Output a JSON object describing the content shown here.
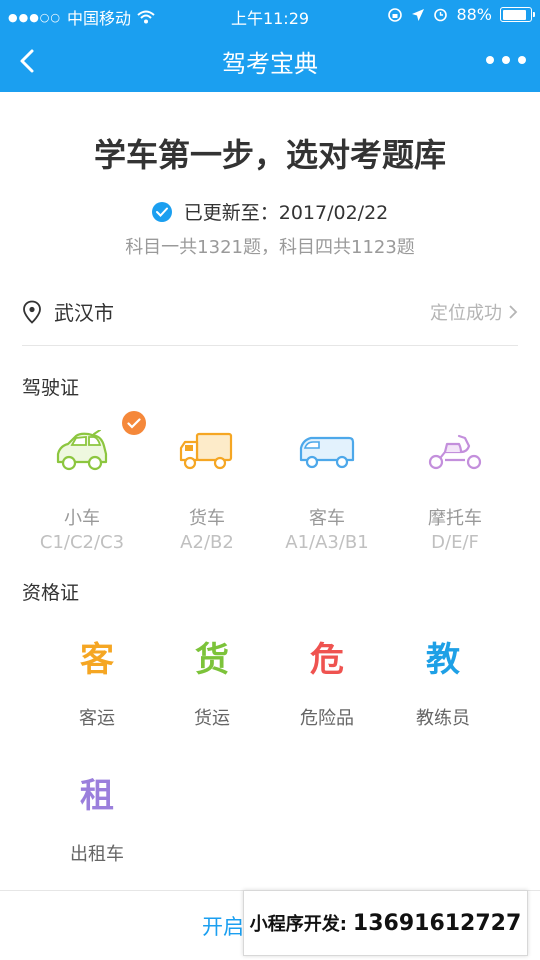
{
  "statusbar": {
    "signal": "●●●○○",
    "carrier": "中国移动",
    "time": "上午11:29",
    "battery_text": "88%",
    "battery_level": 0.88
  },
  "navbar": {
    "title": "驾考宝典"
  },
  "header": {
    "headline": "学车第一步，选对考题库",
    "updated_label": "已更新至：2017/02/22",
    "counts": "科目一共1321题，科目四共1123题"
  },
  "location": {
    "city": "武汉市",
    "status": "定位成功"
  },
  "license": {
    "title": "驾驶证",
    "items": [
      {
        "name": "小车",
        "code": "C1/C2/C3",
        "icon": "car-icon",
        "color": "#8cc63f",
        "selected": true
      },
      {
        "name": "货车",
        "code": "A2/B2",
        "icon": "truck-icon",
        "color": "#f5a623",
        "selected": false
      },
      {
        "name": "客车",
        "code": "A1/A3/B1",
        "icon": "bus-icon",
        "color": "#4da8ea",
        "selected": false
      },
      {
        "name": "摩托车",
        "code": "D/E/F",
        "icon": "motorcycle-icon",
        "color": "#c38fdc",
        "selected": false
      }
    ]
  },
  "qualification": {
    "title": "资格证",
    "items": [
      {
        "glyph": "客",
        "label": "客运",
        "color": "#f5a623"
      },
      {
        "glyph": "货",
        "label": "货运",
        "color": "#7cc33a"
      },
      {
        "glyph": "危",
        "label": "危险品",
        "color": "#ef5350"
      },
      {
        "glyph": "教",
        "label": "教练员",
        "color": "#1ea0e6"
      },
      {
        "glyph": "租",
        "label": "出租车",
        "color": "#9b7fdc"
      }
    ]
  },
  "bottom": {
    "start_label": "开启"
  },
  "watermark": {
    "prefix": "小程序开发:",
    "number": "13691612727"
  },
  "colors": {
    "primary": "#1b9ff0",
    "badge": "#f5883a"
  }
}
